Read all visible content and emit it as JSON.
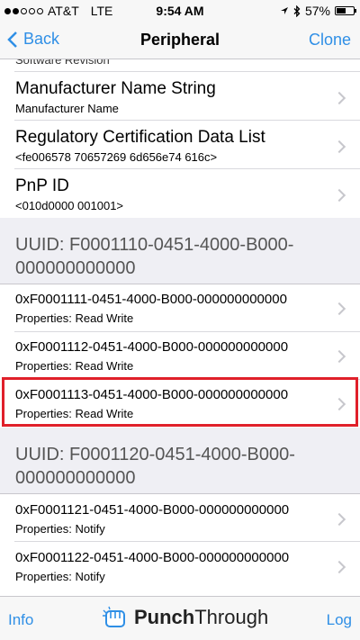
{
  "status_bar": {
    "carrier": "AT&T",
    "network": "LTE",
    "time": "9:54 AM",
    "battery": "57%",
    "battery_level": 0.57
  },
  "nav": {
    "back_label": "Back",
    "title": "Peripheral",
    "action_label": "Clone"
  },
  "rows_top": [
    {
      "title": "Manufacturer Name String",
      "subtitle": "Manufacturer Name"
    },
    {
      "title": "Regulatory Certification Data List",
      "subtitle": "<fe006578 70657269 6d656e74 616c>"
    },
    {
      "title": "PnP ID",
      "subtitle": "<010d0000 001001>"
    }
  ],
  "partial_row_text": "Software Revision",
  "services": [
    {
      "header": "UUID: F0001110-0451-4000-B000-000000000000",
      "characteristics": [
        {
          "uuid": "0xF0001111-0451-4000-B000-000000000000",
          "properties": "Properties: Read Write"
        },
        {
          "uuid": "0xF0001112-0451-4000-B000-000000000000",
          "properties": "Properties: Read Write"
        },
        {
          "uuid": "0xF0001113-0451-4000-B000-000000000000",
          "properties": "Properties: Read Write"
        }
      ]
    },
    {
      "header": "UUID: F0001120-0451-4000-B000-000000000000",
      "characteristics": [
        {
          "uuid": "0xF0001121-0451-4000-B000-000000000000",
          "properties": "Properties: Notify"
        },
        {
          "uuid": "0xF0001122-0451-4000-B000-000000000000",
          "properties": "Properties: Notify"
        }
      ]
    }
  ],
  "tab_bar": {
    "left_label": "Info",
    "brand_part1": "Punch",
    "brand_part2": "Through",
    "right_label": "Log"
  },
  "colors": {
    "accent": "#2f8fe6",
    "highlight": "#e0202a"
  }
}
